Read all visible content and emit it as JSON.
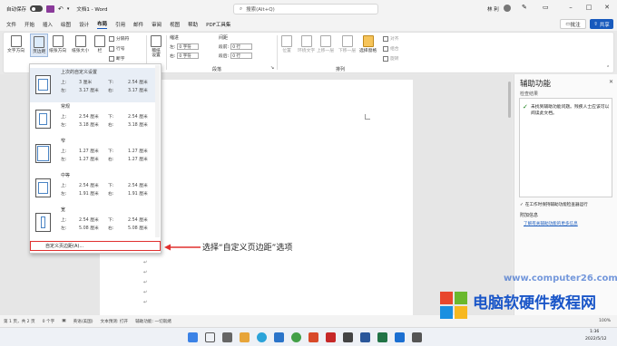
{
  "titlebar": {
    "autosave_label": "自动保存",
    "autosave_state": "关",
    "doc_title": "文档1 - Word",
    "search_placeholder": "搜索(Alt+Q)",
    "user": "林 利"
  },
  "menu": [
    "文件",
    "开始",
    "插入",
    "绘图",
    "设计",
    "布局",
    "引用",
    "邮件",
    "审阅",
    "视图",
    "帮助",
    "PDF工具集"
  ],
  "menu_active": "布局",
  "comment_label": "批注",
  "share_label": "共享",
  "ribbon": {
    "text_direction": "文字方向",
    "margins": "页边距",
    "orientation": "纸张方向",
    "size": "纸张大小",
    "columns": "栏",
    "breaks": "分隔符",
    "line_numbers": "行号",
    "hyphenation": "断字",
    "draft_paper": "稿纸设置",
    "draft_group": "稿纸",
    "indent_title": "缩进",
    "spacing_title": "间距",
    "indent_left": "左:",
    "indent_left_val": "0 字符",
    "indent_right": "右:",
    "indent_right_val": "0 字符",
    "space_before": "段前:",
    "space_before_val": "0 行",
    "space_after": "段后:",
    "space_after_val": "0 行",
    "paragraph_group": "段落",
    "position": "位置",
    "wrap": "环绕文字",
    "forward": "上移一层",
    "backward": "下移一层",
    "selection_pane": "选择窗格",
    "align": "对齐",
    "group": "组合",
    "rotate": "旋转",
    "arrange_group": "排列"
  },
  "margins_menu": {
    "options": [
      {
        "title": "上次的自定义设置",
        "top": "3 厘米",
        "bottom": "2.54 厘米",
        "left": "3.17 厘米",
        "right": "3.17 厘米"
      },
      {
        "title": "常规",
        "top": "2.54 厘米",
        "bottom": "2.54 厘米",
        "left": "3.18 厘米",
        "right": "3.18 厘米"
      },
      {
        "title": "窄",
        "top": "1.27 厘米",
        "bottom": "1.27 厘米",
        "left": "1.27 厘米",
        "right": "1.27 厘米"
      },
      {
        "title": "中等",
        "top": "2.54 厘米",
        "bottom": "2.54 厘米",
        "left": "1.91 厘米",
        "right": "1.91 厘米"
      },
      {
        "title": "宽",
        "top": "2.54 厘米",
        "bottom": "2.54 厘米",
        "left": "5.08 厘米",
        "right": "5.08 厘米"
      }
    ],
    "lbl_top": "上:",
    "lbl_bottom": "下:",
    "lbl_left": "左:",
    "lbl_right": "右:",
    "custom": "自定义页边距(A)..."
  },
  "annotation": "选择“自定义页边距”选项",
  "pane": {
    "title": "辅助功能",
    "section": "检查结果",
    "result_text": "未找到辅助功能问题。残疾人士应该可以阅读此文档。",
    "keep_running": "在工作时保持辅助功能检查器运行",
    "extra_title": "附加信息",
    "link": "了解有关辅助功能的更多信息"
  },
  "status": {
    "page": "第 1 页，共 2 页",
    "words": "0 个字",
    "lang": "英语(美国)",
    "predict": "文本预测: 打开",
    "access": "辅助功能: 一切就绪",
    "zoom": "100%"
  },
  "taskbar": {
    "time": "1:36",
    "date": "2022/5/12"
  },
  "watermark": {
    "cn": "电脑软硬件教程网",
    "url": "www.computer26.com"
  },
  "colors": {
    "accent": "#185abd",
    "red_highlight": "#e0302f",
    "watermark_blue": "#1a56c8"
  }
}
